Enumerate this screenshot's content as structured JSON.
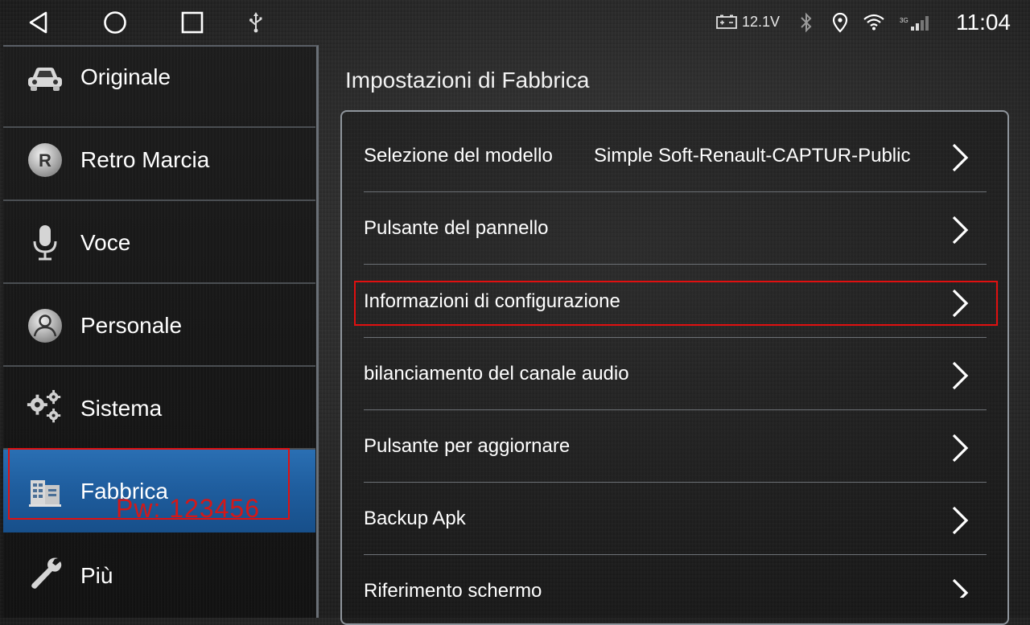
{
  "status_bar": {
    "voltage": "12.1V",
    "time": "11:04",
    "network": "3G",
    "icons": [
      "back-icon",
      "home-icon",
      "recent-apps-icon",
      "usb-icon",
      "battery-icon",
      "bluetooth-icon",
      "location-icon",
      "wifi-icon",
      "signal-icon"
    ]
  },
  "sidebar": {
    "items": [
      {
        "label": "Originale",
        "icon": "car-icon"
      },
      {
        "label": "Retro Marcia",
        "icon": "reverse-r-icon"
      },
      {
        "label": "Voce",
        "icon": "microphone-icon"
      },
      {
        "label": "Personale",
        "icon": "person-icon"
      },
      {
        "label": "Sistema",
        "icon": "gears-icon"
      },
      {
        "label": "Fabbrica",
        "icon": "factory-icon",
        "active": true
      },
      {
        "label": "Più",
        "icon": "wrench-icon"
      }
    ],
    "password_note": "Pw: 123456"
  },
  "main": {
    "title": "Impostazioni di Fabbrica",
    "rows": [
      {
        "label": "Selezione del modello",
        "value": "Simple Soft-Renault-CAPTUR-Public"
      },
      {
        "label": "Pulsante del pannello",
        "value": ""
      },
      {
        "label": "Informazioni di configurazione",
        "value": "",
        "highlighted": true
      },
      {
        "label": "bilanciamento del canale audio",
        "value": ""
      },
      {
        "label": "Pulsante per aggiornare",
        "value": ""
      },
      {
        "label": "Backup Apk",
        "value": ""
      },
      {
        "label": "Riferimento schermo",
        "value": ""
      }
    ]
  },
  "colors": {
    "active_item": "#1f5e9f",
    "annotation_red": "#e01010"
  }
}
